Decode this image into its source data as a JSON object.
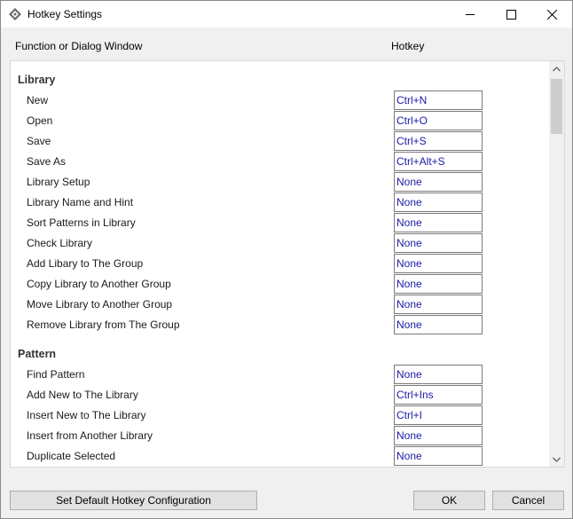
{
  "window": {
    "title": "Hotkey Settings"
  },
  "header": {
    "function_label": "Function or Dialog Window",
    "hotkey_label": "Hotkey"
  },
  "sections": [
    {
      "title": "Library",
      "items": [
        {
          "label": "New",
          "hotkey": "Ctrl+N"
        },
        {
          "label": "Open",
          "hotkey": "Ctrl+O"
        },
        {
          "label": "Save",
          "hotkey": "Ctrl+S"
        },
        {
          "label": "Save As",
          "hotkey": "Ctrl+Alt+S"
        },
        {
          "label": "Library Setup",
          "hotkey": "None"
        },
        {
          "label": "Library Name and Hint",
          "hotkey": "None"
        },
        {
          "label": "Sort Patterns in Library",
          "hotkey": "None"
        },
        {
          "label": "Check Library",
          "hotkey": "None"
        },
        {
          "label": "Add Libary to The Group",
          "hotkey": "None"
        },
        {
          "label": "Copy Library to Another Group",
          "hotkey": "None"
        },
        {
          "label": "Move Library to Another Group",
          "hotkey": "None"
        },
        {
          "label": "Remove Library from The Group",
          "hotkey": "None"
        }
      ]
    },
    {
      "title": "Pattern",
      "items": [
        {
          "label": "Find Pattern",
          "hotkey": "None"
        },
        {
          "label": "Add New to The Library",
          "hotkey": "Ctrl+Ins"
        },
        {
          "label": "Insert New to The Library",
          "hotkey": "Ctrl+I"
        },
        {
          "label": "Insert from Another Library",
          "hotkey": "None"
        },
        {
          "label": "Duplicate Selected",
          "hotkey": "None"
        }
      ]
    }
  ],
  "buttons": {
    "default_config": "Set Default Hotkey Configuration",
    "ok": "OK",
    "cancel": "Cancel"
  }
}
